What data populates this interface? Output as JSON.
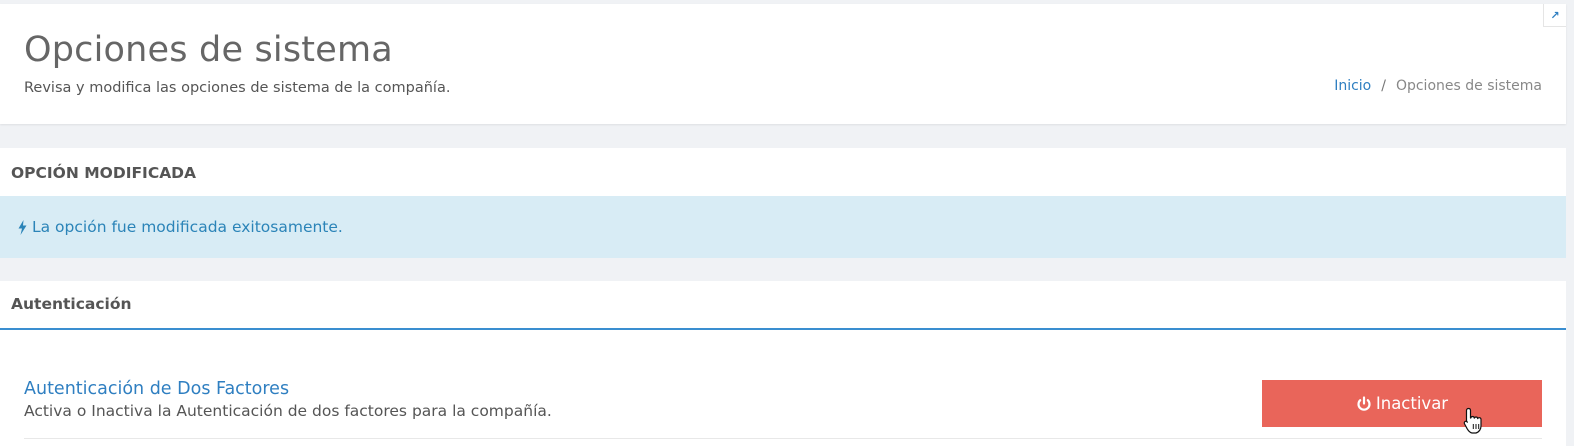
{
  "header": {
    "title": "Opciones de sistema",
    "subtitle": "Revisa y modifica las opciones de sistema de la compañía.",
    "breadcrumb": {
      "home": "Inicio",
      "separator": "/",
      "current": "Opciones de sistema"
    },
    "corner_icon": "↗"
  },
  "message_panel": {
    "title": "OPCIÓN MODIFICADA",
    "alert_icon": "bolt-icon",
    "alert_text": "La opción fue modificada exitosamente."
  },
  "auth_panel": {
    "title": "Autenticación",
    "option": {
      "title": "Autenticación de Dos Factores",
      "description": "Activa o Inactiva la Autenticación de dos factores para la compañía.",
      "button_icon": "power-icon",
      "button_label": "Inactivar"
    }
  },
  "colors": {
    "accent": "#2f7fc1",
    "alert_bg": "#d8ecf5",
    "danger": "#e9655a"
  }
}
